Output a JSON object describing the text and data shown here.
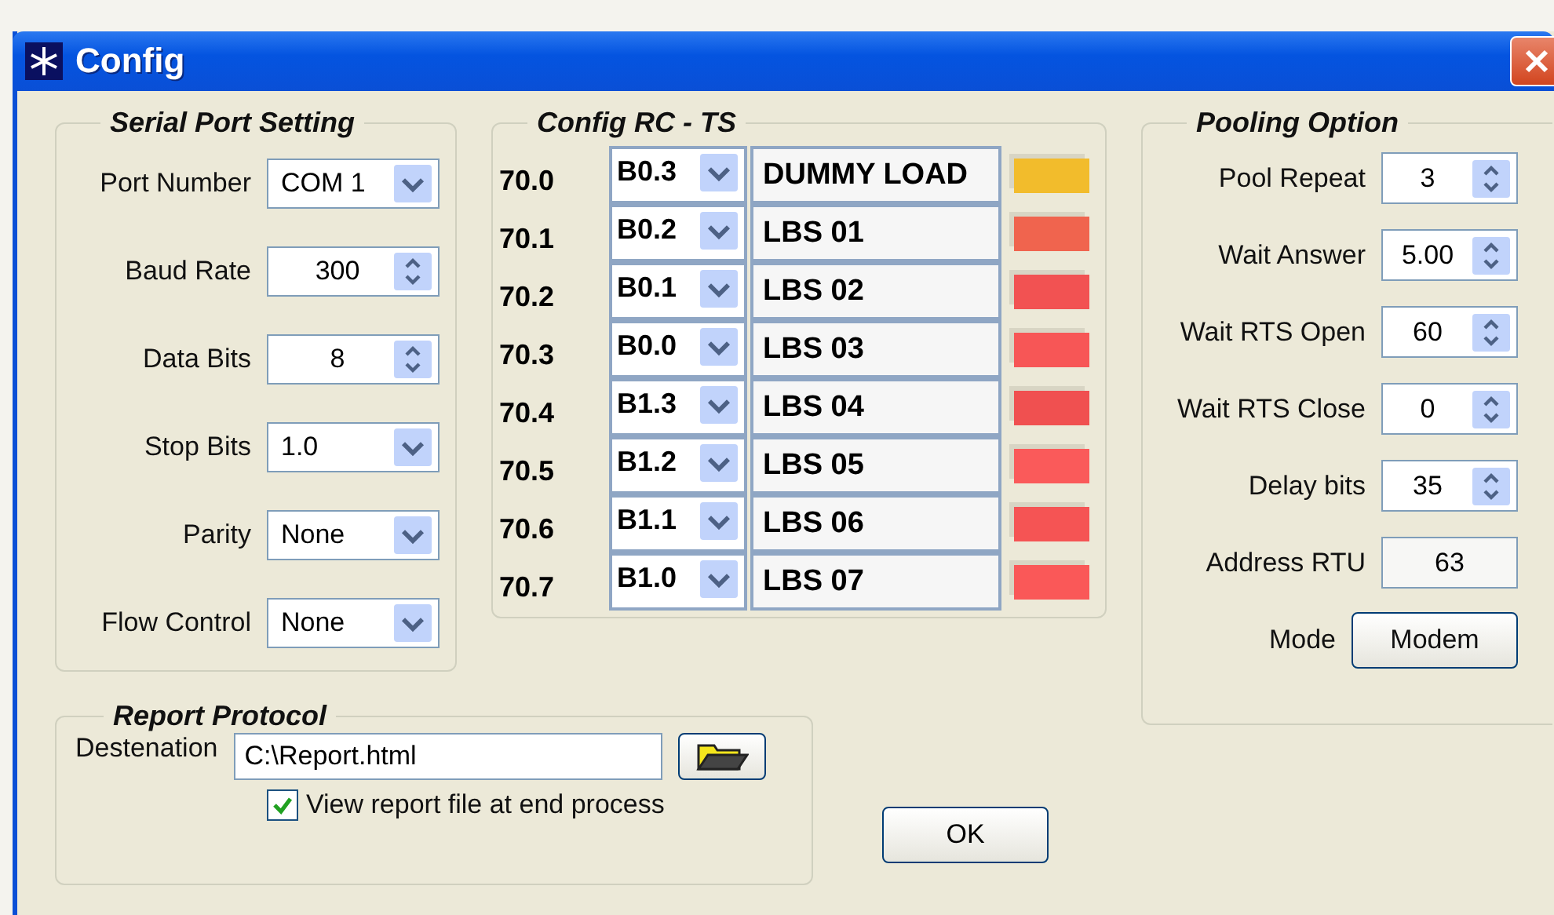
{
  "window": {
    "title": "Config"
  },
  "serial_port": {
    "title": "Serial Port Setting",
    "fields": [
      {
        "label": "Port Number",
        "value": "COM 1",
        "kind": "dropdown"
      },
      {
        "label": "Baud Rate",
        "value": "300",
        "kind": "spinner"
      },
      {
        "label": "Data Bits",
        "value": "8",
        "kind": "spinner"
      },
      {
        "label": "Stop Bits",
        "value": "1.0",
        "kind": "dropdown"
      },
      {
        "label": "Parity",
        "value": "None",
        "kind": "dropdown"
      },
      {
        "label": "Flow Control",
        "value": "None",
        "kind": "dropdown"
      }
    ]
  },
  "config_rc_ts": {
    "title": "Config RC - TS",
    "rows": [
      {
        "address": "70.0",
        "bit": "B0.3",
        "name": "DUMMY LOAD",
        "color": "#f2bc2c"
      },
      {
        "address": "70.1",
        "bit": "B0.2",
        "name": "LBS 01",
        "color": "#f0644e"
      },
      {
        "address": "70.2",
        "bit": "B0.1",
        "name": "LBS 02",
        "color": "#f25252"
      },
      {
        "address": "70.3",
        "bit": "B0.0",
        "name": "LBS 03",
        "color": "#f75656"
      },
      {
        "address": "70.4",
        "bit": "B1.3",
        "name": "LBS 04",
        "color": "#f05050"
      },
      {
        "address": "70.5",
        "bit": "B1.2",
        "name": "LBS 05",
        "color": "#fa5a5a"
      },
      {
        "address": "70.6",
        "bit": "B1.1",
        "name": "LBS 06",
        "color": "#f55454"
      },
      {
        "address": "70.7",
        "bit": "B1.0",
        "name": "LBS 07",
        "color": "#fa5858"
      }
    ]
  },
  "pooling_option": {
    "title": "Pooling Option",
    "fields": [
      {
        "label": "Pool Repeat",
        "value": "3",
        "kind": "spinner"
      },
      {
        "label": "Wait Answer",
        "value": "5.00",
        "kind": "spinner"
      },
      {
        "label": "Wait RTS Open",
        "value": "60",
        "kind": "spinner"
      },
      {
        "label": "Wait RTS Close",
        "value": "0",
        "kind": "spinner"
      },
      {
        "label": "Delay bits",
        "value": "35",
        "kind": "spinner"
      },
      {
        "label": "Address RTU",
        "value": "63",
        "kind": "text"
      },
      {
        "label": "Mode",
        "value": "Modem",
        "kind": "button"
      }
    ]
  },
  "report_protocol": {
    "title": "Report Protocol",
    "destination_label": "Destenation",
    "destination": "C:\\Report.html",
    "view_report": {
      "label": "View report file at end process",
      "checked": true
    }
  },
  "buttons": [
    "OK"
  ]
}
